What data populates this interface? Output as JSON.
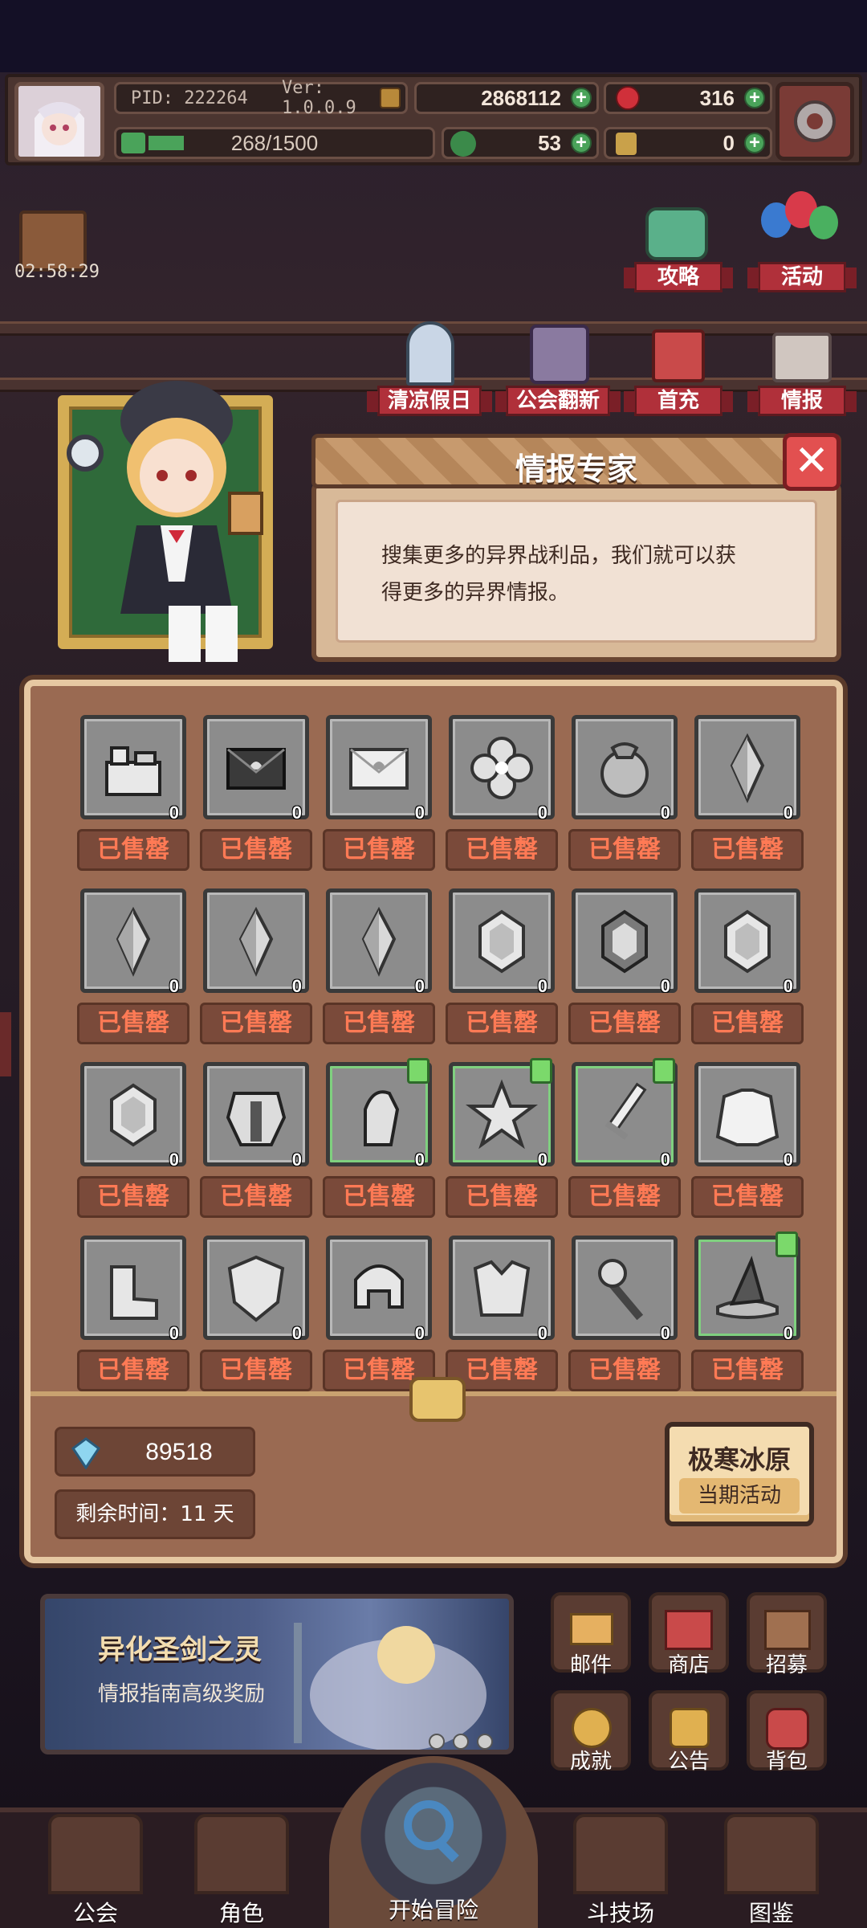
{
  "hud": {
    "pid": "PID: 222264",
    "version": "Ver: 1.0.0.9",
    "gold": "2868112",
    "gems": "316",
    "exp": "268/1500",
    "clover": "53",
    "tickets": "0"
  },
  "gift_timer": "02:58:29",
  "side_menu": {
    "guide": "攻略",
    "activity": "活动",
    "holiday": "清凉假日",
    "guild_refresh": "公会翻新",
    "first_charge": "首充",
    "intel": "情报"
  },
  "dialog": {
    "title": "情报专家",
    "close": "✕",
    "text_line1": "搜集更多的异界战利品，我们就可以获",
    "text_line2": "得更多的异界情报。"
  },
  "items": [
    {
      "icon": "castle-icon",
      "count": "0",
      "status": "已售罄",
      "upgrade": false
    },
    {
      "icon": "dark-letter-icon",
      "count": "0",
      "status": "已售罄",
      "upgrade": false
    },
    {
      "icon": "light-letter-icon",
      "count": "0",
      "status": "已售罄",
      "upgrade": false
    },
    {
      "icon": "flower-icon",
      "count": "0",
      "status": "已售罄",
      "upgrade": false
    },
    {
      "icon": "pouch-icon",
      "count": "0",
      "status": "已售罄",
      "upgrade": false
    },
    {
      "icon": "crystal-icon",
      "count": "0",
      "status": "已售罄",
      "upgrade": false
    },
    {
      "icon": "crystal-icon",
      "count": "0",
      "status": "已售罄",
      "upgrade": false
    },
    {
      "icon": "crystal-icon",
      "count": "0",
      "status": "已售罄",
      "upgrade": false
    },
    {
      "icon": "crystal-icon",
      "count": "0",
      "status": "已售罄",
      "upgrade": false
    },
    {
      "icon": "gem-icon",
      "count": "0",
      "status": "已售罄",
      "upgrade": false
    },
    {
      "icon": "dark-gem-icon",
      "count": "0",
      "status": "已售罄",
      "upgrade": false
    },
    {
      "icon": "gem-icon",
      "count": "0",
      "status": "已售罄",
      "upgrade": false
    },
    {
      "icon": "gem-icon",
      "count": "0",
      "status": "已售罄",
      "upgrade": false
    },
    {
      "icon": "armor-icon",
      "count": "0",
      "status": "已售罄",
      "upgrade": false
    },
    {
      "icon": "gauntlet-icon",
      "count": "0",
      "status": "已售罄",
      "upgrade": true
    },
    {
      "icon": "star-emblem-icon",
      "count": "0",
      "status": "已售罄",
      "upgrade": true
    },
    {
      "icon": "sword-icon",
      "count": "0",
      "status": "已售罄",
      "upgrade": true
    },
    {
      "icon": "robe-icon",
      "count": "0",
      "status": "已售罄",
      "upgrade": false
    },
    {
      "icon": "boots-icon",
      "count": "0",
      "status": "已售罄",
      "upgrade": false
    },
    {
      "icon": "shield-icon",
      "count": "0",
      "status": "已售罄",
      "upgrade": false
    },
    {
      "icon": "helmet-icon",
      "count": "0",
      "status": "已售罄",
      "upgrade": false
    },
    {
      "icon": "chestplate-icon",
      "count": "0",
      "status": "已售罄",
      "upgrade": false
    },
    {
      "icon": "mace-icon",
      "count": "0",
      "status": "已售罄",
      "upgrade": false
    },
    {
      "icon": "witch-hat-icon",
      "count": "0",
      "status": "已售罄",
      "upgrade": true
    }
  ],
  "footer": {
    "crystal_value": "89518",
    "time_left": "剩余时间：11 天",
    "event_name": "极寒冰原",
    "event_sub": "当期活动"
  },
  "banner": {
    "title": "异化圣剑之灵",
    "subtitle": "情报指南高级奖励"
  },
  "menu": {
    "mail": "邮件",
    "shop": "商店",
    "recruit": "招募",
    "achievement": "成就",
    "notice": "公告",
    "bag": "背包"
  },
  "nav": {
    "guild": "公会",
    "character": "角色",
    "start": "开始冒险",
    "arena": "斗技场",
    "codex": "图鉴"
  },
  "colors": {
    "sold_out_text": "#ff7a55",
    "panel_brown": "#9a6a52",
    "upgrade_green": "#7bd96b"
  }
}
